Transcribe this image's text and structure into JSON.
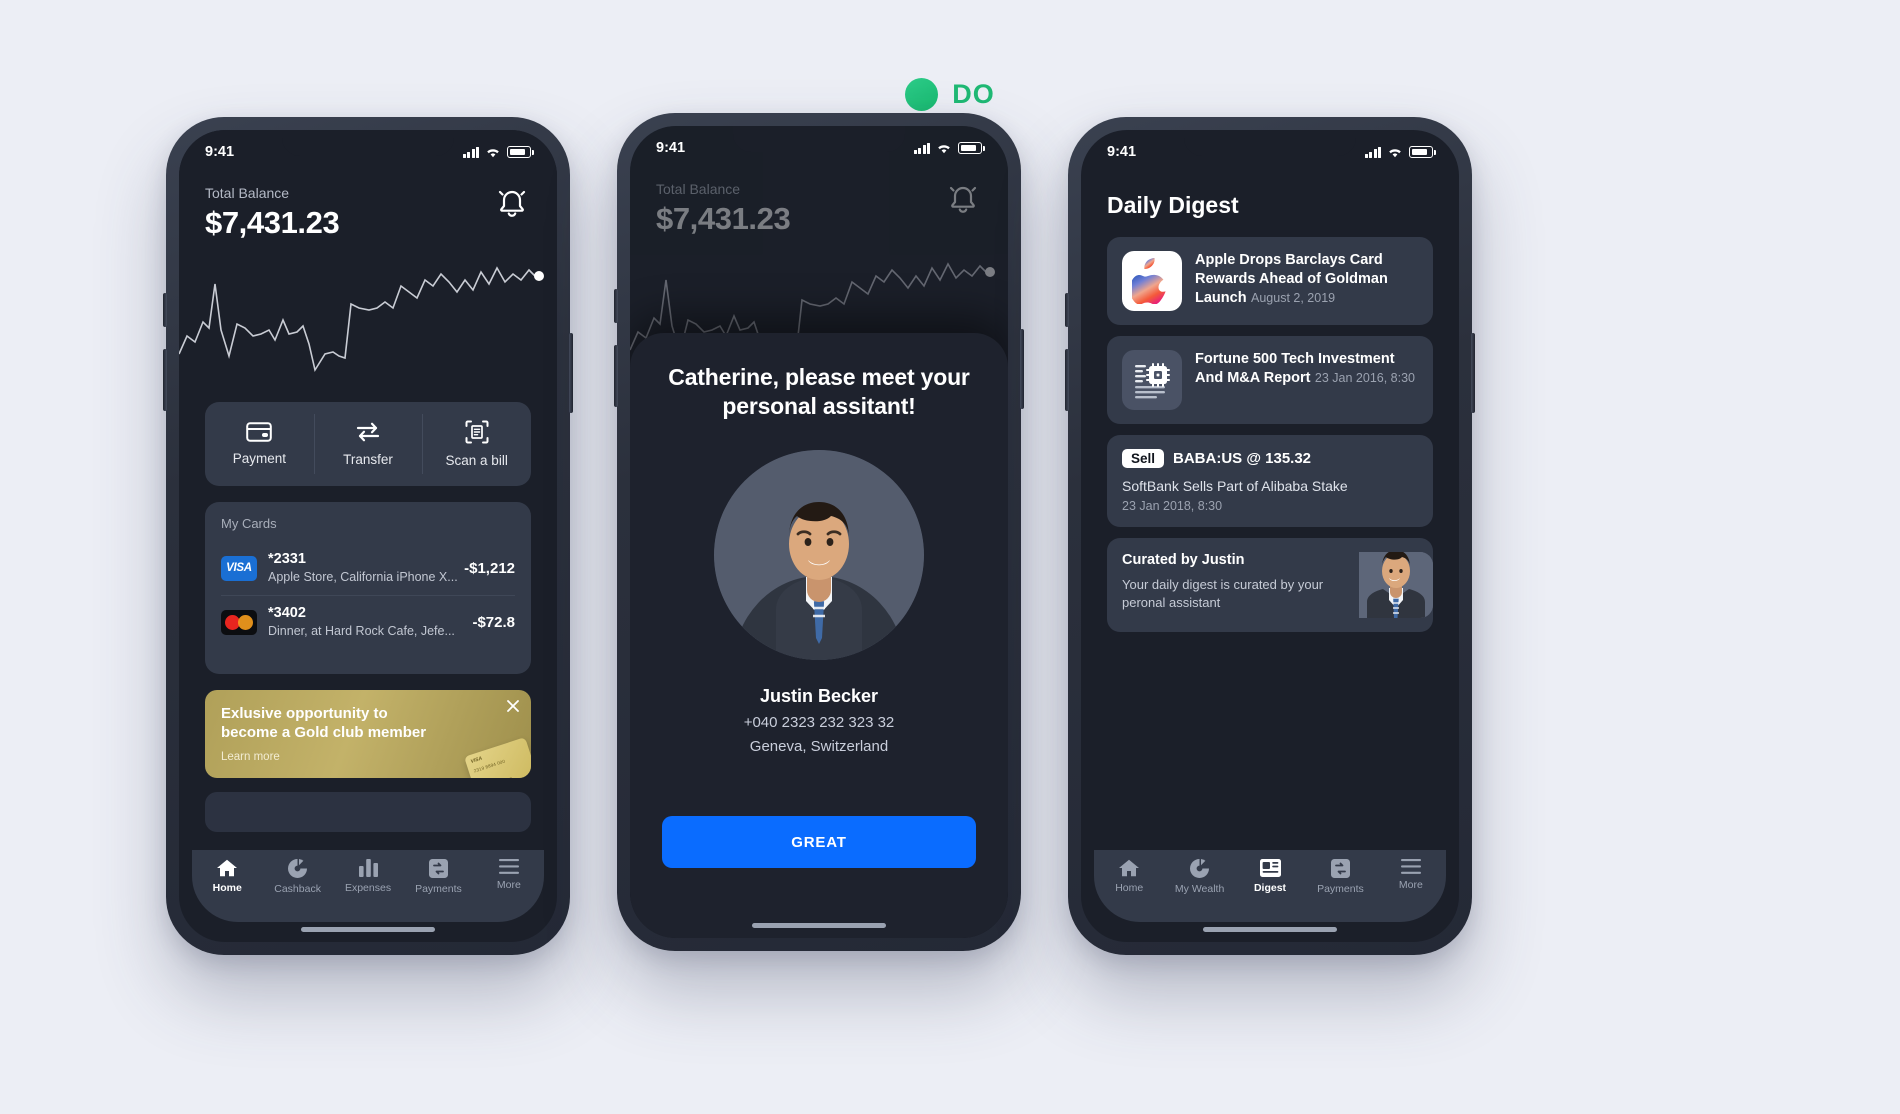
{
  "brand": {
    "name": "DO",
    "dot_color": "#22b573",
    "text_color": "#1fb974"
  },
  "status_bar": {
    "time": "9:41"
  },
  "phone1": {
    "balance_label": "Total Balance",
    "balance_value": "$7,431.23",
    "notification_icon": "bell-icon",
    "actions": [
      {
        "label": "Payment",
        "icon": "credit-card-icon"
      },
      {
        "label": "Transfer",
        "icon": "transfer-arrows-icon"
      },
      {
        "label": "Scan a bill",
        "icon": "scan-bill-icon"
      }
    ],
    "cards_section_title": "My Cards",
    "transactions": [
      {
        "brand": "VISA",
        "brand_icon": "visa-logo-icon",
        "number": "*2331",
        "description": "Apple Store, California iPhone X...",
        "amount": "-$1,212"
      },
      {
        "brand": "Mastercard",
        "brand_icon": "mastercard-logo-icon",
        "number": "*3402",
        "description": "Dinner, at Hard Rock Cafe, Jefe...",
        "amount": "-$72.8"
      }
    ],
    "promo": {
      "title": "Exlusive opportunity to become a Gold club member",
      "link": "Learn more",
      "close_icon": "close-icon"
    },
    "tabs": [
      {
        "label": "Home",
        "icon": "home-icon",
        "active": true
      },
      {
        "label": "Cashback",
        "icon": "donut-chart-icon",
        "active": false
      },
      {
        "label": "Expenses",
        "icon": "bar-chart-icon",
        "active": false
      },
      {
        "label": "Payments",
        "icon": "payments-icon",
        "active": false
      },
      {
        "label": "More",
        "icon": "hamburger-icon",
        "active": false
      }
    ]
  },
  "phone2": {
    "balance_label": "Total Balance",
    "balance_value": "$7,431.23",
    "notification_icon": "bell-icon",
    "sheet_title": "Catherine, please meet your personal assitant!",
    "avatar_icon": "assistant-avatar",
    "person_name": "Justin Becker",
    "person_phone": "+040 2323 232 323 32",
    "person_location": "Geneva, Switzerland",
    "cta_label": "GREAT"
  },
  "phone3": {
    "page_title": "Daily Digest",
    "items": [
      {
        "type": "news",
        "icon": "apple-logo-icon",
        "title": "Apple Drops Barclays Card Rewards Ahead of Goldman Launch",
        "date": "August 2, 2019"
      },
      {
        "type": "news",
        "icon": "chip-report-icon",
        "title": "Fortune 500 Tech Investment And M&A Report",
        "date": "23 Jan 2016, 8:30"
      },
      {
        "type": "ticker",
        "badge": "Sell",
        "ticker": "BABA:US @ 135.32",
        "title": "SoftBank Sells Part of Alibaba Stake",
        "date": "23 Jan 2018, 8:30"
      },
      {
        "type": "curated",
        "title": "Curated by Justin",
        "body": "Your daily digest is curated by your peronal assistant",
        "photo_icon": "assistant-photo"
      }
    ],
    "tabs": [
      {
        "label": "Home",
        "icon": "home-icon",
        "active": false
      },
      {
        "label": "My Wealth",
        "icon": "donut-chart-icon",
        "active": false
      },
      {
        "label": "Digest",
        "icon": "news-icon",
        "active": true
      },
      {
        "label": "Payments",
        "icon": "payments-icon",
        "active": false
      },
      {
        "label": "More",
        "icon": "hamburger-icon",
        "active": false
      }
    ]
  }
}
